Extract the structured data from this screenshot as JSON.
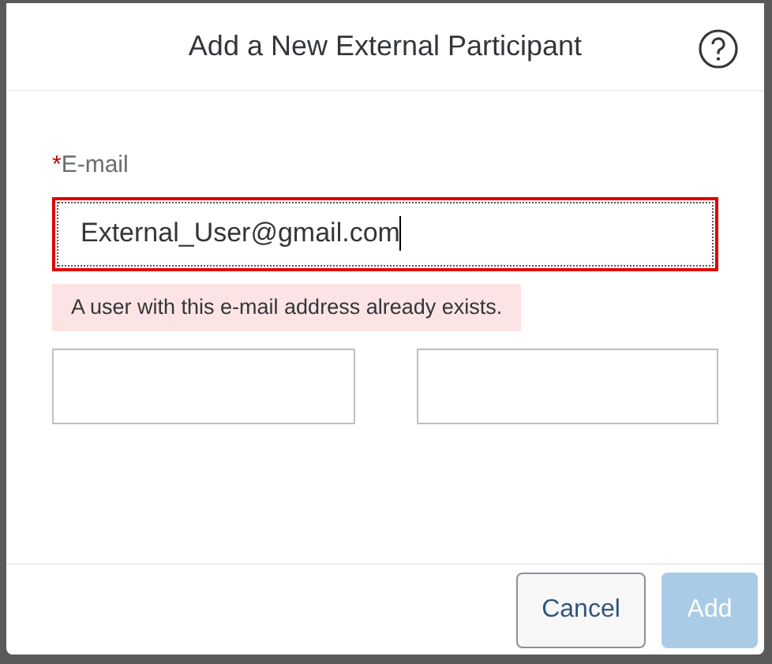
{
  "dialog": {
    "title": "Add a New External Participant"
  },
  "email": {
    "label": "E-mail",
    "required_mark": "*",
    "value": "External_User@gmail.com",
    "error": true,
    "message": "A user with this e-mail address already exists."
  },
  "name_fields": [
    {
      "value_empty": true
    },
    {
      "value_empty": true
    }
  ],
  "buttons": [
    {
      "label": "Cancel",
      "kind": "secondary",
      "disabled": false
    },
    {
      "label": "Add",
      "kind": "primary",
      "disabled": true
    }
  ]
}
